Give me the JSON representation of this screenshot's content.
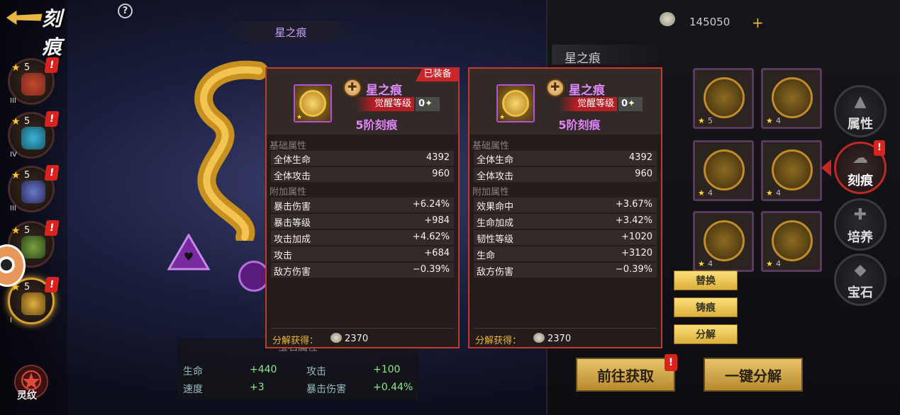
{
  "header": {
    "title": "刻痕",
    "help": "?"
  },
  "heroes": [
    {
      "level": "5",
      "rank": "III",
      "colors": [
        "#7a2a20",
        "#c34a2a"
      ]
    },
    {
      "level": "5",
      "rank": "IV",
      "colors": [
        "#1a5a6a",
        "#3ab5d8"
      ]
    },
    {
      "level": "5",
      "rank": "III",
      "colors": [
        "#2a2a5a",
        "#6a7acc"
      ]
    },
    {
      "level": "5",
      "rank": "",
      "colors": [
        "#2a4a1a",
        "#7aa040"
      ]
    },
    {
      "level": "5",
      "rank": "I",
      "colors": [
        "#6a4a10",
        "#e0b040"
      ]
    }
  ],
  "hero_alert": "!",
  "lingwen_label": "灵纹",
  "scene": {
    "title": "星之痕"
  },
  "gem_stats": {
    "heading": "宝石属性",
    "rows": [
      {
        "k1": "生命",
        "v1": "+440",
        "k2": "攻击",
        "v2": "+100"
      },
      {
        "k1": "速度",
        "v1": "+3",
        "k2": "暴击伤害",
        "v2": "+0.44%"
      }
    ]
  },
  "tooltips": [
    {
      "equipped": "已装备",
      "name": "星之痕",
      "awaken_label": "觉醒等级",
      "awaken_value": "0",
      "tier": "5阶刻痕",
      "base_label": "基础属性",
      "base": [
        {
          "k": "全体生命",
          "v": "4392"
        },
        {
          "k": "全体攻击",
          "v": "960"
        }
      ],
      "extra_label": "附加属性",
      "extra": [
        {
          "k": "暴击伤害",
          "v": "+6.24%"
        },
        {
          "k": "暴击等级",
          "v": "+984"
        },
        {
          "k": "攻击加成",
          "v": "+4.62%"
        },
        {
          "k": "攻击",
          "v": "+684"
        },
        {
          "k": "敌方伤害",
          "v": "−0.39%"
        }
      ],
      "decompose_label": "分解获得：",
      "decompose_value": "2370"
    },
    {
      "equipped": "",
      "name": "星之痕",
      "awaken_label": "觉醒等级",
      "awaken_value": "0",
      "tier": "5阶刻痕",
      "base_label": "基础属性",
      "base": [
        {
          "k": "全体生命",
          "v": "4392"
        },
        {
          "k": "全体攻击",
          "v": "960"
        }
      ],
      "extra_label": "附加属性",
      "extra": [
        {
          "k": "效果命中",
          "v": "+3.67%"
        },
        {
          "k": "生命加成",
          "v": "+3.42%"
        },
        {
          "k": "韧性等级",
          "v": "+1020"
        },
        {
          "k": "生命",
          "v": "+3120"
        },
        {
          "k": "敌方伤害",
          "v": "−0.39%"
        }
      ],
      "decompose_label": "分解获得：",
      "decompose_value": "2370"
    }
  ],
  "currency": {
    "amount": "145050",
    "plus": "+"
  },
  "panel": {
    "title": "星之痕"
  },
  "slots": [
    {
      "level": "5"
    },
    {
      "level": "4"
    },
    {
      "level": "4"
    },
    {
      "level": "4"
    },
    {
      "level": "4"
    },
    {
      "level": "4"
    }
  ],
  "actions": {
    "replace": "替换",
    "forge": "铸痕",
    "decompose": "分解"
  },
  "bottom_buttons": {
    "goto_obtain": "前往获取",
    "one_key_decompose": "一键分解"
  },
  "side_tabs": [
    {
      "label": "属性"
    },
    {
      "label": "刻痕"
    },
    {
      "label": "培养"
    },
    {
      "label": "宝石"
    }
  ]
}
